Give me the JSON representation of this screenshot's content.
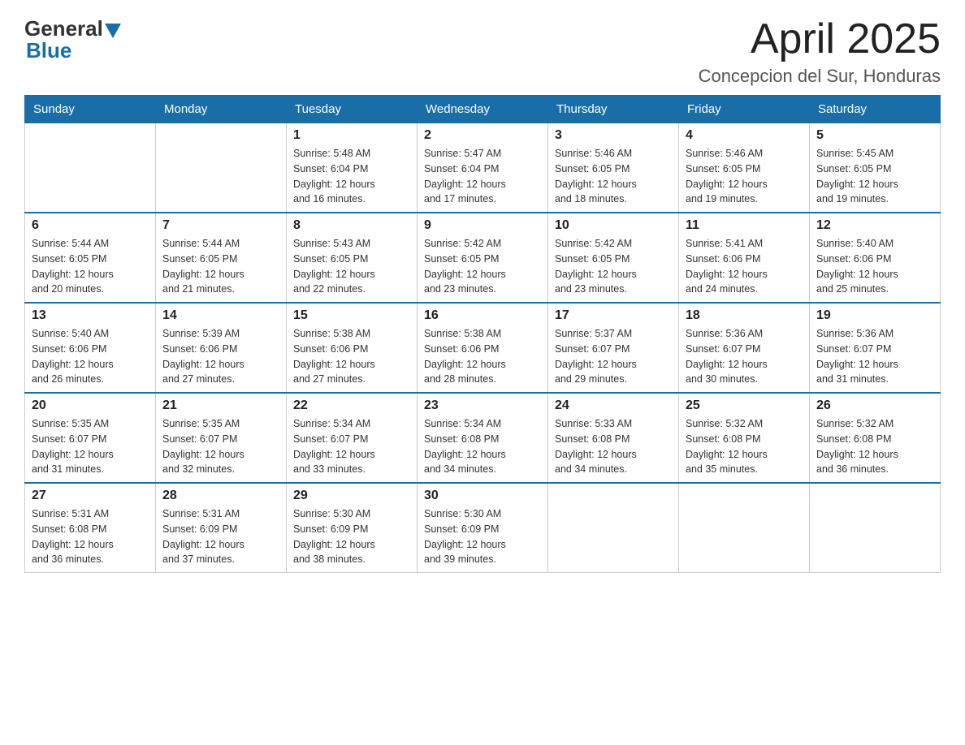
{
  "header": {
    "logo": {
      "general": "General",
      "blue": "Blue"
    },
    "title": "April 2025",
    "location": "Concepcion del Sur, Honduras"
  },
  "days_of_week": [
    "Sunday",
    "Monday",
    "Tuesday",
    "Wednesday",
    "Thursday",
    "Friday",
    "Saturday"
  ],
  "weeks": [
    [
      {
        "day": "",
        "info": ""
      },
      {
        "day": "",
        "info": ""
      },
      {
        "day": "1",
        "info": "Sunrise: 5:48 AM\nSunset: 6:04 PM\nDaylight: 12 hours\nand 16 minutes."
      },
      {
        "day": "2",
        "info": "Sunrise: 5:47 AM\nSunset: 6:04 PM\nDaylight: 12 hours\nand 17 minutes."
      },
      {
        "day": "3",
        "info": "Sunrise: 5:46 AM\nSunset: 6:05 PM\nDaylight: 12 hours\nand 18 minutes."
      },
      {
        "day": "4",
        "info": "Sunrise: 5:46 AM\nSunset: 6:05 PM\nDaylight: 12 hours\nand 19 minutes."
      },
      {
        "day": "5",
        "info": "Sunrise: 5:45 AM\nSunset: 6:05 PM\nDaylight: 12 hours\nand 19 minutes."
      }
    ],
    [
      {
        "day": "6",
        "info": "Sunrise: 5:44 AM\nSunset: 6:05 PM\nDaylight: 12 hours\nand 20 minutes."
      },
      {
        "day": "7",
        "info": "Sunrise: 5:44 AM\nSunset: 6:05 PM\nDaylight: 12 hours\nand 21 minutes."
      },
      {
        "day": "8",
        "info": "Sunrise: 5:43 AM\nSunset: 6:05 PM\nDaylight: 12 hours\nand 22 minutes."
      },
      {
        "day": "9",
        "info": "Sunrise: 5:42 AM\nSunset: 6:05 PM\nDaylight: 12 hours\nand 23 minutes."
      },
      {
        "day": "10",
        "info": "Sunrise: 5:42 AM\nSunset: 6:05 PM\nDaylight: 12 hours\nand 23 minutes."
      },
      {
        "day": "11",
        "info": "Sunrise: 5:41 AM\nSunset: 6:06 PM\nDaylight: 12 hours\nand 24 minutes."
      },
      {
        "day": "12",
        "info": "Sunrise: 5:40 AM\nSunset: 6:06 PM\nDaylight: 12 hours\nand 25 minutes."
      }
    ],
    [
      {
        "day": "13",
        "info": "Sunrise: 5:40 AM\nSunset: 6:06 PM\nDaylight: 12 hours\nand 26 minutes."
      },
      {
        "day": "14",
        "info": "Sunrise: 5:39 AM\nSunset: 6:06 PM\nDaylight: 12 hours\nand 27 minutes."
      },
      {
        "day": "15",
        "info": "Sunrise: 5:38 AM\nSunset: 6:06 PM\nDaylight: 12 hours\nand 27 minutes."
      },
      {
        "day": "16",
        "info": "Sunrise: 5:38 AM\nSunset: 6:06 PM\nDaylight: 12 hours\nand 28 minutes."
      },
      {
        "day": "17",
        "info": "Sunrise: 5:37 AM\nSunset: 6:07 PM\nDaylight: 12 hours\nand 29 minutes."
      },
      {
        "day": "18",
        "info": "Sunrise: 5:36 AM\nSunset: 6:07 PM\nDaylight: 12 hours\nand 30 minutes."
      },
      {
        "day": "19",
        "info": "Sunrise: 5:36 AM\nSunset: 6:07 PM\nDaylight: 12 hours\nand 31 minutes."
      }
    ],
    [
      {
        "day": "20",
        "info": "Sunrise: 5:35 AM\nSunset: 6:07 PM\nDaylight: 12 hours\nand 31 minutes."
      },
      {
        "day": "21",
        "info": "Sunrise: 5:35 AM\nSunset: 6:07 PM\nDaylight: 12 hours\nand 32 minutes."
      },
      {
        "day": "22",
        "info": "Sunrise: 5:34 AM\nSunset: 6:07 PM\nDaylight: 12 hours\nand 33 minutes."
      },
      {
        "day": "23",
        "info": "Sunrise: 5:34 AM\nSunset: 6:08 PM\nDaylight: 12 hours\nand 34 minutes."
      },
      {
        "day": "24",
        "info": "Sunrise: 5:33 AM\nSunset: 6:08 PM\nDaylight: 12 hours\nand 34 minutes."
      },
      {
        "day": "25",
        "info": "Sunrise: 5:32 AM\nSunset: 6:08 PM\nDaylight: 12 hours\nand 35 minutes."
      },
      {
        "day": "26",
        "info": "Sunrise: 5:32 AM\nSunset: 6:08 PM\nDaylight: 12 hours\nand 36 minutes."
      }
    ],
    [
      {
        "day": "27",
        "info": "Sunrise: 5:31 AM\nSunset: 6:08 PM\nDaylight: 12 hours\nand 36 minutes."
      },
      {
        "day": "28",
        "info": "Sunrise: 5:31 AM\nSunset: 6:09 PM\nDaylight: 12 hours\nand 37 minutes."
      },
      {
        "day": "29",
        "info": "Sunrise: 5:30 AM\nSunset: 6:09 PM\nDaylight: 12 hours\nand 38 minutes."
      },
      {
        "day": "30",
        "info": "Sunrise: 5:30 AM\nSunset: 6:09 PM\nDaylight: 12 hours\nand 39 minutes."
      },
      {
        "day": "",
        "info": ""
      },
      {
        "day": "",
        "info": ""
      },
      {
        "day": "",
        "info": ""
      }
    ]
  ]
}
